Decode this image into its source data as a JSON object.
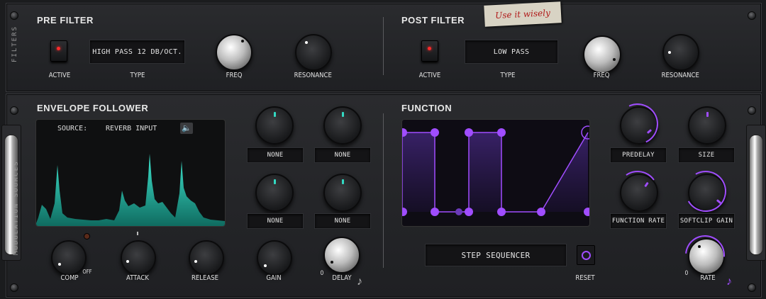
{
  "filters": {
    "side_label": "FILTERS",
    "pre": {
      "title": "PRE FILTER",
      "active_label": "ACTIVE",
      "type_label": "TYPE",
      "type_value": "HIGH PASS 12 DB/OCT.",
      "freq_label": "FREQ",
      "resonance_label": "RESONANCE"
    },
    "post": {
      "title": "POST FILTER",
      "active_label": "ACTIVE",
      "type_label": "TYPE",
      "type_value": "LOW PASS",
      "freq_label": "FREQ",
      "resonance_label": "RESONANCE"
    },
    "sticky_note": "Use it wisely"
  },
  "modulation": {
    "side_label": "MODULATION SOURCES",
    "envelope": {
      "title": "ENVELOPE FOLLOWER",
      "source_label": "SOURCE:",
      "source_value": "REVERB INPUT",
      "targets": [
        "NONE",
        "NONE",
        "NONE",
        "NONE"
      ],
      "comp_label": "COMP",
      "comp_off": "OFF",
      "attack_label": "ATTACK",
      "release_label": "RELEASE",
      "gain_label": "GAIN",
      "delay_label": "DELAY",
      "delay_zero": "0"
    },
    "function": {
      "title": "FUNCTION",
      "targets": [
        "PREDELAY",
        "SIZE",
        "FUNCTION RATE",
        "SOFTCLIP GAIN"
      ],
      "mode_value": "STEP SEQUENCER",
      "reset_label": "RESET",
      "rate_label": "RATE",
      "rate_zero": "0"
    }
  },
  "colors": {
    "accent": "#a04dff",
    "teal": "#33d9c2",
    "led": "#ff2b2b"
  }
}
